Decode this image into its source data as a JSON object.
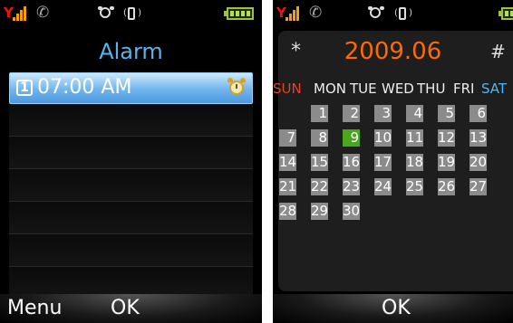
{
  "left_screen": {
    "title": "Alarm",
    "alarms": [
      {
        "index": "1",
        "time": "07:00 AM"
      }
    ],
    "softkeys": {
      "left": "Menu",
      "center": "OK"
    }
  },
  "right_screen": {
    "calendar": {
      "prev": "*",
      "month_label": "2009.06",
      "next": "#",
      "weekdays": [
        "SUN",
        "MON",
        "TUE",
        "WED",
        "THU",
        "FRI",
        "SAT"
      ],
      "today": 9,
      "weeks": [
        [
          "",
          "1",
          "2",
          "3",
          "4",
          "5",
          "6"
        ],
        [
          "7",
          "8",
          "9",
          "10",
          "11",
          "12",
          "13"
        ],
        [
          "14",
          "15",
          "16",
          "17",
          "18",
          "19",
          "20"
        ],
        [
          "21",
          "22",
          "23",
          "24",
          "25",
          "26",
          "27"
        ],
        [
          "28",
          "29",
          "30",
          "",
          "",
          "",
          ""
        ]
      ]
    },
    "softkeys": {
      "center": "OK"
    }
  },
  "colors": {
    "title_blue": "#58b4ee",
    "month_orange": "#ff6a00",
    "sunday_red": "#e8412c",
    "saturday_blue": "#58b4ee",
    "today_green": "#4aa61a",
    "day_cell_gray": "#8b8b8b",
    "selected_row_blue": "#6fb4ee"
  },
  "icons": [
    "signal-icon",
    "call-icon",
    "alarm-clock-icon",
    "vibrate-icon",
    "battery-icon",
    "alarm-set-icon"
  ]
}
